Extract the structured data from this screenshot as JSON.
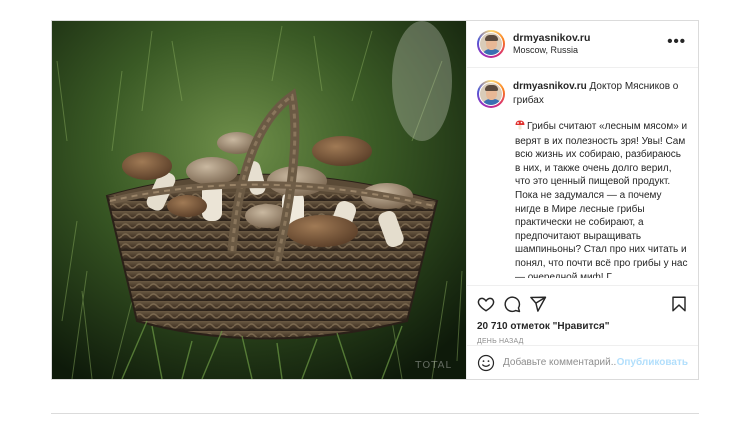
{
  "post": {
    "username": "drmyasnikov.ru",
    "location": "Moscow, Russia",
    "more_icon": "more-horizontal-icon",
    "caption_title": "Доктор Мясников о грибах",
    "caption_text": "Грибы считают «лесным мясом» и верят в их полезность зря! Увы! Сам всю жизнь их собираю, разбираюсь в них, и также очень долго верил, что это ценный пищевой продукт. Пока не задумался — а почему нигде в Мире лесные грибы практически не собирают, а предпочитают выращивать шампиньоны? Стал про них читать и понял, что почти всё про грибы у нас — очередной миф! Г",
    "photo_watermark": "TOTAL",
    "likes": "20 710 отметок \"Нравится\"",
    "time": "День назад",
    "comment_placeholder": "Добавьте комментарий...",
    "publish_label": "Опубликовать",
    "icons": {
      "like": "heart-icon",
      "comment": "comment-icon",
      "share": "paper-plane-icon",
      "save": "bookmark-icon",
      "emoji": "emoji-icon",
      "caption_emoji": "mushroom-icon"
    },
    "colors": {
      "publish_disabled": "#b2dffc",
      "border": "#dbdbdb",
      "secondary_text": "#8e8e8e"
    }
  }
}
